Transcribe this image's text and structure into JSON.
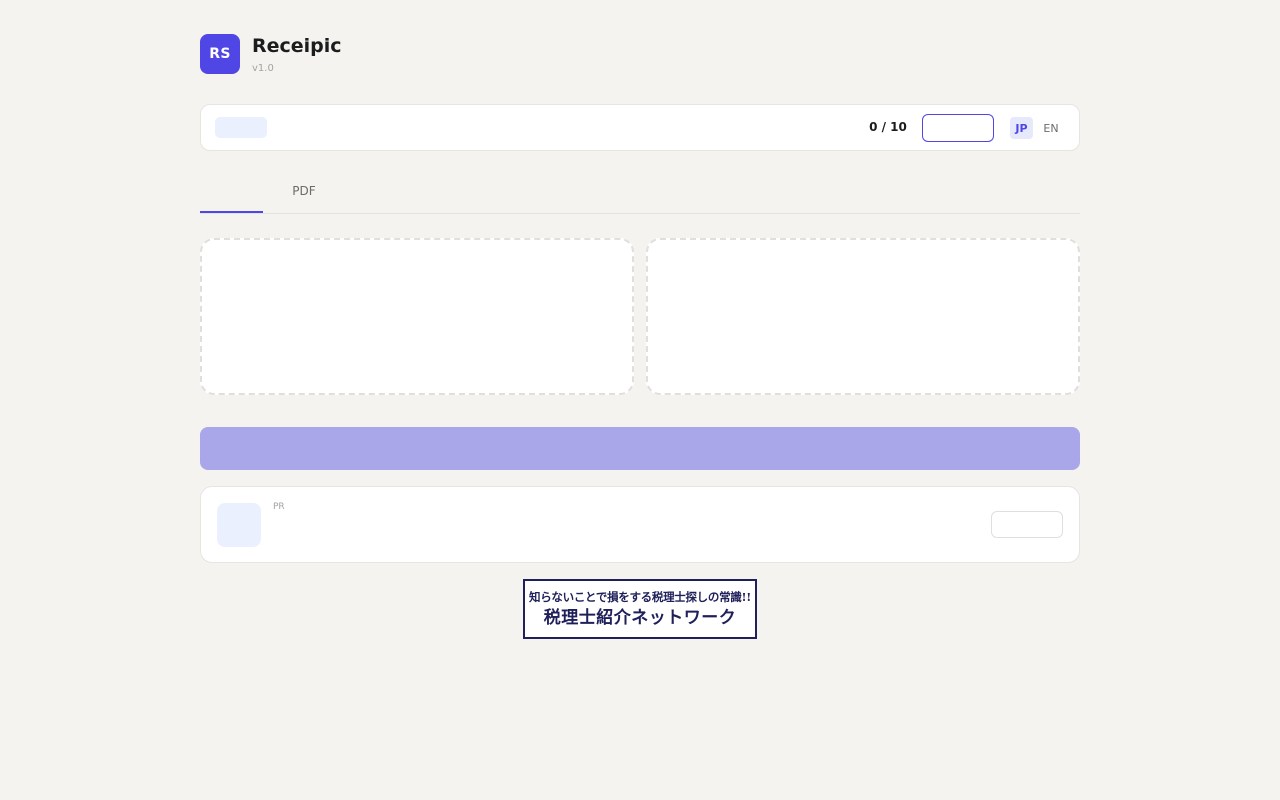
{
  "app": {
    "logo_text": "RS",
    "title": "Receipic",
    "version": "v1.0"
  },
  "toolbar": {
    "counter": "0 / 10",
    "input_value": "",
    "languages": [
      "JP",
      "EN"
    ],
    "active_language": "JP"
  },
  "tabs": {
    "items": [
      "",
      "PDF"
    ],
    "active_index": 0
  },
  "ad": {
    "label": "PR"
  },
  "banner": {
    "line1": "知らないことで損をする税理士探しの常識!!",
    "line2": "税理士紹介ネットワーク"
  },
  "colors": {
    "accent": "#4f46e5",
    "accent_soft": "#a9a6ea",
    "chip": "#eaf0fd",
    "background": "#f4f3f0",
    "banner_navy": "#1f1f5a"
  }
}
